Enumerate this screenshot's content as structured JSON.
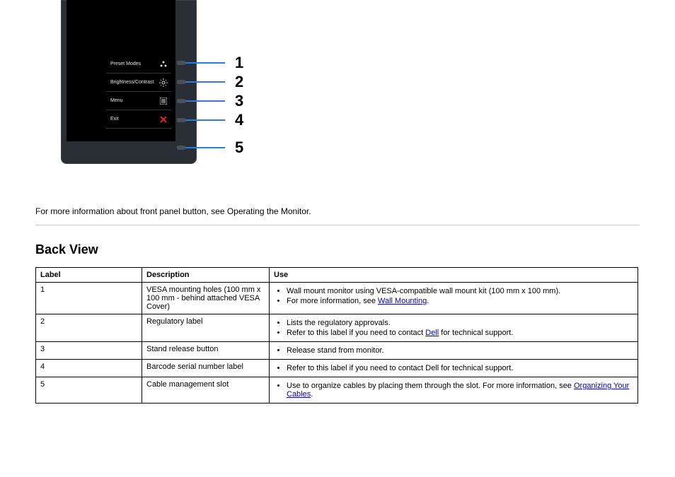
{
  "osd": {
    "items": [
      {
        "label": "Preset Modes",
        "icon": "preset-modes-icon"
      },
      {
        "label": "Brightness/Contrast",
        "icon": "brightness-icon"
      },
      {
        "label": "Menu",
        "icon": "menu-icon"
      },
      {
        "label": "Exit",
        "icon": "close-icon"
      }
    ]
  },
  "numbers": [
    "1",
    "2",
    "3",
    "4",
    "5"
  ],
  "body_paragraph": "For more information about front panel button, see Operating the Monitor.",
  "section_title": "Back View",
  "table": {
    "headers": [
      "Label",
      "Description",
      "Use"
    ],
    "rows": [
      {
        "label": "1",
        "desc": "VESA mounting holes (100 mm x 100 mm - behind attached VESA Cover)",
        "use": [
          {
            "text": "Wall mount monitor using VESA-compatible wall mount kit (100 mm x 100 mm)."
          },
          {
            "text": "For more information, see ",
            "link": "Wall Mounting",
            "after": "."
          }
        ]
      },
      {
        "label": "2",
        "desc": "Regulatory label",
        "use": [
          {
            "text": "Lists the regulatory approvals."
          },
          {
            "text": "Refer to this label if you need to contact ",
            "link": "Dell",
            "after": " for technical support."
          }
        ]
      },
      {
        "label": "3",
        "desc": "Stand release button",
        "use": [
          {
            "text": "Release stand from monitor."
          }
        ]
      },
      {
        "label": "4",
        "desc": "Barcode serial number label",
        "use": [
          {
            "text": "Refer to this label if you need to contact Dell for technical support."
          }
        ]
      },
      {
        "label": "5",
        "desc": "Cable management slot",
        "use": [
          {
            "text": "Use to organize cables by placing them through the slot. For more information, see ",
            "link": "Organizing Your Cables",
            "after": "."
          }
        ]
      }
    ]
  }
}
